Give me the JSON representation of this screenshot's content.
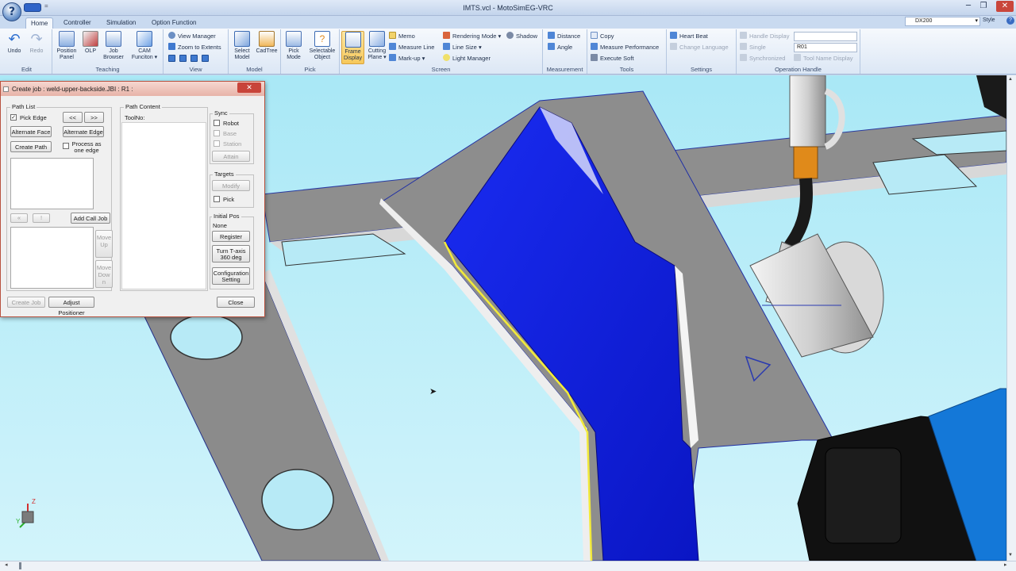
{
  "window": {
    "title": "IMTS.vcl - MotoSimEG-VRC",
    "orb": "?"
  },
  "ribbon": {
    "tabs": [
      "Home",
      "Controller",
      "Simulation",
      "Option Function"
    ],
    "controller": "DX200",
    "style_label": "Style",
    "groups": {
      "edit": {
        "label": "Edit",
        "undo": "Undo",
        "redo": "Redo"
      },
      "teaching": {
        "label": "Teaching",
        "position_panel": "Position Panel",
        "olp": "OLP",
        "job_browser": "Job Browser",
        "cam_function": "CAM Funciton"
      },
      "view": {
        "label": "View",
        "view_manager": "View Manager",
        "zoom_to_extents": "Zoom to Extents"
      },
      "model": {
        "label": "Model",
        "select_model": "Select Model",
        "cadtree": "CadTree"
      },
      "pick": {
        "label": "Pick",
        "pick_mode": "Pick Mode",
        "selectable_object": "Selectable Object"
      },
      "screen": {
        "label": "Screen",
        "frame_display": "Frame Display",
        "cutting_plane": "Cutting Plane",
        "memo": "Memo",
        "measure_line": "Measure Line",
        "markup": "Mark-up",
        "rendering_mode": "Rendering Mode",
        "line_size": "Line Size",
        "light_manager": "Light Manager",
        "shadow": "Shadow"
      },
      "measurement": {
        "label": "Measurement",
        "distance": "Distance",
        "angle": "Angle"
      },
      "tools": {
        "label": "Tools",
        "copy": "Copy",
        "measure_performance": "Measure Performance",
        "execute_soft": "Execute Soft"
      },
      "settings": {
        "label": "Settings",
        "heart_beat": "Heart Beat",
        "change_language": "Change Language"
      },
      "operation_handle": {
        "label": "Operation Handle",
        "handle_display": "Handle Display",
        "single": "Single",
        "synchronized": "Synchronized",
        "tool_name_display": "Tool Name Display",
        "robot": "R01"
      }
    }
  },
  "dialog": {
    "title": "Create job : weld-upper-backside.JBI : R1 :",
    "path_list": {
      "label": "Path List",
      "pick_edge": "Pick Edge",
      "prev": "<<",
      "next": ">>",
      "alternate_face": "Alternate Face",
      "alternate_edge": "Alternate Edge",
      "create_path": "Create Path",
      "process_as_one_edge": "Process as one edge",
      "left": "«",
      "bang": "!",
      "add_call_job": "Add Call Job",
      "move_up": "Move Up",
      "move_down": "Move Dow n"
    },
    "path_content": {
      "label": "Path Content",
      "header": "ToolNo:"
    },
    "sync": {
      "label": "Sync",
      "robot": "Robot",
      "base": "Base",
      "station": "Station",
      "attain": "Attain"
    },
    "targets": {
      "label": "Targets",
      "modify": "Modify",
      "pick": "Pick"
    },
    "initial_pos": {
      "label": "Initial Pos",
      "value": "None",
      "register": "Register",
      "turn_t_axis": "Turn T-axis 360 deg",
      "configuration_setting": "Configuration Setting"
    },
    "create_job": "Create Job",
    "adjust_positioner": "Adjust Positioner",
    "close": "Close"
  },
  "viewport": {
    "axis_z": "Z",
    "axis_y": "Y",
    "colors": {
      "sky": "#b7eaf6",
      "part_blue": "#0a1ee6",
      "frame_gray": "#8c8c8c",
      "weld_line": "#f2ea3a",
      "robot_blue": "#1478d8"
    }
  }
}
